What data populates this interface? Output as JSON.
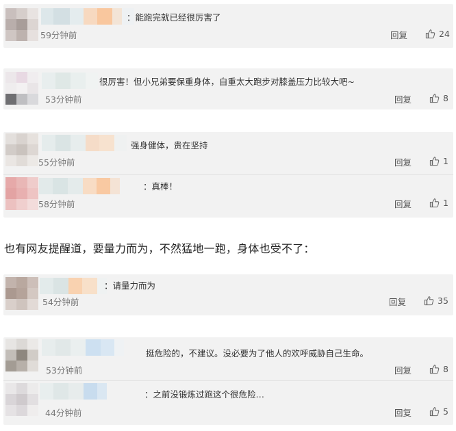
{
  "comments": [
    {
      "text": "：能跑完就已经很厉害了",
      "time": "59分钟前",
      "reply": "回复",
      "likes": "24"
    },
    {
      "text": "很厉害！但小兄弟要保重身体，自重太大跑步对膝盖压力比较大吧~",
      "time": "53分钟前",
      "reply": "回复",
      "likes": "8"
    },
    {
      "text": "强身健体，贵在坚持",
      "time": "55分钟前",
      "reply": "回复",
      "likes": "1"
    },
    {
      "text": "：真棒！",
      "time": "58分钟前",
      "reply": "回复",
      "likes": "1"
    },
    {
      "text": "：请量力而为",
      "time": "54分钟前",
      "reply": "回复",
      "likes": "35"
    },
    {
      "text": "挺危险的，不建议。没必要为了他人的欢呼威胁自己生命。",
      "time": "53分钟前",
      "reply": "回复",
      "likes": "8"
    },
    {
      "text": "：之前没锻炼过跑这个很危险…",
      "time": "44分钟前",
      "reply": "回复",
      "likes": "5"
    }
  ],
  "separator_text": "也有网友提醒道，要量力而为，不然猛地一跑，身体也受不了：",
  "icons": {
    "like": "thumbs-up-icon"
  },
  "colors": {
    "card_bg": "#f2f2f2",
    "text": "#333333",
    "meta": "#777777"
  }
}
